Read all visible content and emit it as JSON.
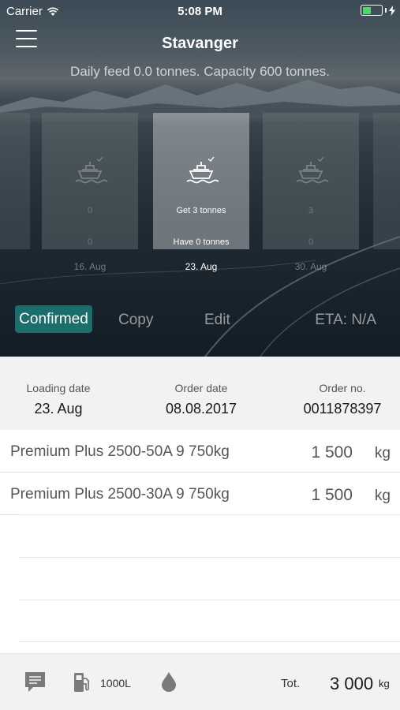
{
  "status_bar": {
    "carrier": "Carrier",
    "time": "5:08 PM",
    "battery_level": 0.45
  },
  "nav": {
    "title": "Stavanger",
    "subtitle": "Daily feed 0.0 tonnes. Capacity 600 tonnes."
  },
  "weeks": [
    {
      "get": "",
      "have": "",
      "date": ""
    },
    {
      "get": "0",
      "have": "0",
      "date": "16. Aug"
    },
    {
      "get": "Get 3 tonnes",
      "have": "Have 0 tonnes",
      "date": "23. Aug"
    },
    {
      "get": "3",
      "have": "0",
      "date": "30. Aug"
    },
    {
      "get": "",
      "have": "",
      "date": ""
    }
  ],
  "actions": {
    "confirmed": "Confirmed",
    "copy": "Copy",
    "edit": "Edit",
    "eta": "ETA: N/A"
  },
  "order_info": {
    "loading_label": "Loading date",
    "loading_value": "23. Aug",
    "order_label": "Order date",
    "order_value": "08.08.2017",
    "number_label": "Order no.",
    "number_value": "0011878397"
  },
  "items": [
    {
      "name": "Premium Plus 2500-50A 9 750kg",
      "qty": "1 500",
      "unit": "kg"
    },
    {
      "name": "Premium Plus 2500-30A 9 750kg",
      "qty": "1 500",
      "unit": "kg"
    }
  ],
  "footer": {
    "chat_icon": "chat-bubble-icon",
    "fuel_icon": "fuel-pump-icon",
    "fuel_label": "1000L",
    "drop_icon": "drop-icon",
    "total_label": "Tot.",
    "total_value": "3 000",
    "total_unit": "kg"
  },
  "colors": {
    "accent": "#1a6e6c",
    "footer_bg": "#f2f2f2",
    "battery": "#4cd964"
  }
}
